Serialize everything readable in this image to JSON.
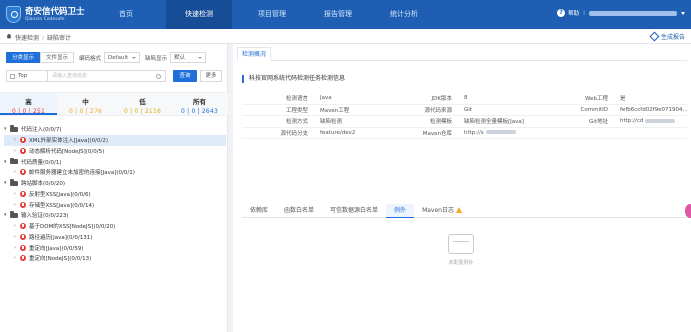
{
  "app": {
    "title": "奇安信代码卫士",
    "subtitle": "Qianxin Codesafe",
    "help_label": "帮助"
  },
  "nav": {
    "items": [
      {
        "label": "首页",
        "active": false
      },
      {
        "label": "快速检测",
        "active": true
      },
      {
        "label": "项目管理",
        "active": false
      },
      {
        "label": "报告管理",
        "active": false
      },
      {
        "label": "统计分析",
        "active": false
      }
    ]
  },
  "breadcrumb": {
    "items": [
      "快速检测",
      "缺陷审计"
    ],
    "generate_report": "生成报告"
  },
  "filters": {
    "view_category": "分类显示",
    "view_file": "文件显示",
    "encoding_label": "编码格式",
    "encoding_value": "Default",
    "defect_display_label": "缺陷显示",
    "defect_display_value": "默认",
    "top_label": "Top",
    "search_placeholder": "请输入查询信息",
    "query_button": "查询",
    "more_button": "更多"
  },
  "severity": [
    {
      "name": "高",
      "counts": "0 | 0 | 251",
      "color": "#e53935"
    },
    {
      "name": "中",
      "counts": "0 | 0 | 276",
      "color": "#f5a623"
    },
    {
      "name": "低",
      "counts": "0 | 0 | 2116",
      "color": "#d4b106"
    },
    {
      "name": "所有",
      "counts": "0 | 0 | 2643",
      "color": "#1e6fd9"
    }
  ],
  "tree": [
    {
      "type": "cat",
      "label": "代码注入(0/0/7)",
      "expanded": true
    },
    {
      "type": "leaf",
      "label": "XML外部实体注入[Java](0/0/2)",
      "selected": true
    },
    {
      "type": "leaf",
      "label": "动态解析代码[NodeJS](0/0/5)"
    },
    {
      "type": "cat",
      "label": "代码质量(0/0/1)",
      "expanded": true
    },
    {
      "type": "leaf",
      "label": "邮件服务器建立未加密的连接[Java](0/0/1)"
    },
    {
      "type": "cat",
      "label": "跨站脚本(0/0/20)",
      "expanded": true
    },
    {
      "type": "leaf",
      "label": "反射型XSS[Java](0/0/6)"
    },
    {
      "type": "leaf",
      "label": "存储型XSS[Java](0/0/14)"
    },
    {
      "type": "cat",
      "label": "输入验证(0/0/223)",
      "expanded": true
    },
    {
      "type": "leaf",
      "label": "基于DOM的XSS[NodeJS](0/0/20)"
    },
    {
      "type": "leaf",
      "label": "路径遍历[Java](0/0/131)"
    },
    {
      "type": "leaf",
      "label": "重定向[Java](0/0/59)"
    },
    {
      "type": "leaf",
      "label": "重定向[NodeJS](0/0/13)"
    }
  ],
  "detail": {
    "tab": "检测概况",
    "section_title": "科技官网系统代码检测任务检测信息",
    "rows": [
      {
        "k1": "检测语言",
        "v1": "Java",
        "k2": "JDK版本",
        "v2": "8",
        "k3": "Web工程",
        "v3": "是"
      },
      {
        "k1": "工程类型",
        "v1": "Maven工程",
        "k2": "源代码来源",
        "v2": "Git",
        "k3": "CommitID",
        "v3": "fefb6ccfd02f9e071904..."
      },
      {
        "k1": "检测方式",
        "v1": "缺陷检测",
        "k2": "检测模板",
        "v2": "缺陷检测全量模板[Java]",
        "k3": "Git地址",
        "v3": "http://cd"
      },
      {
        "k1": "源代码分支",
        "v1": "feature/dev2",
        "k2": "Maven仓库",
        "v2": "http://s",
        "k3": "",
        "v3": ""
      }
    ],
    "subtabs": [
      {
        "label": "依赖库",
        "active": false
      },
      {
        "label": "函数白名单",
        "active": false
      },
      {
        "label": "可信数据源白名单",
        "active": false
      },
      {
        "label": "例外",
        "active": true
      },
      {
        "label": "Maven日志",
        "active": false
      }
    ],
    "empty_text": "未配置例外"
  }
}
